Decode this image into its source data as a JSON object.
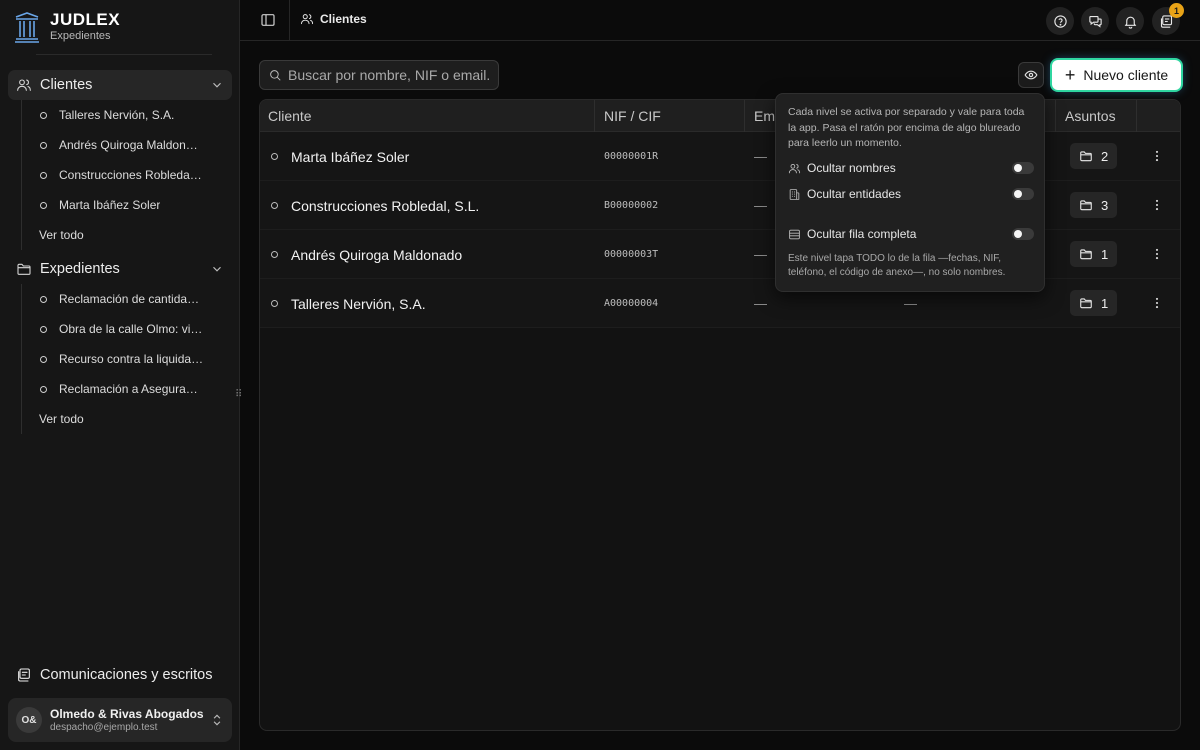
{
  "brand": {
    "title": "JUDLEX",
    "subtitle": "Expedientes"
  },
  "sidebar": {
    "clients": {
      "label": "Clientes",
      "items": [
        "Talleres Nervión, S.A.",
        "Andrés Quiroga Maldonado",
        "Construcciones Robledal, S.L.",
        "Marta Ibáñez Soler"
      ],
      "see_all": "Ver todo"
    },
    "cases": {
      "label": "Expedientes",
      "items": [
        "Reclamación de cantidad por impago",
        "Obra de la calle Olmo: vicios ocultos",
        "Recurso contra la liquidación",
        "Reclamación a Aseguradora"
      ],
      "see_all": "Ver todo"
    },
    "comms": "Comunicaciones y escritos",
    "account": {
      "initials": "O&",
      "name": "Olmedo & Rivas Abogados",
      "email": "despacho@ejemplo.test"
    }
  },
  "topbar": {
    "breadcrumb": "Clientes",
    "notification_count": "1"
  },
  "search": {
    "placeholder": "Buscar por nombre, NIF o email."
  },
  "new_client_label": "Nuevo cliente",
  "table": {
    "headers": {
      "client": "Cliente",
      "nif": "NIF / CIF",
      "email": "Email",
      "cases": "Asuntos"
    },
    "rows": [
      {
        "name": "Marta Ibáñez Soler",
        "nif": "00000001R",
        "email": "—",
        "phone": "",
        "cases": "2"
      },
      {
        "name": "Construcciones Robledal, S.L.",
        "nif": "B00000002",
        "email": "—",
        "phone": "",
        "cases": "3"
      },
      {
        "name": "Andrés Quiroga Maldonado",
        "nif": "00000003T",
        "email": "—",
        "phone": "",
        "cases": "1"
      },
      {
        "name": "Talleres Nervión, S.A.",
        "nif": "A00000004",
        "email": "—",
        "phone": "—",
        "cases": "1"
      }
    ]
  },
  "privacy_popover": {
    "intro": "Cada nivel se activa por separado y vale para toda la app. Pasa el ratón por encima de algo blureado para leerlo un momento.",
    "options": [
      "Ocultar nombres",
      "Ocultar entidades",
      "Ocultar fila completa"
    ],
    "note": "Este nivel tapa TODO lo de la fila —fechas, NIF, teléfono, el código de anexo—, no solo nombres."
  },
  "colors": {
    "accent_glow": "#2fd6a0",
    "badge": "#e8a317",
    "logo": "#6aa6e8"
  }
}
